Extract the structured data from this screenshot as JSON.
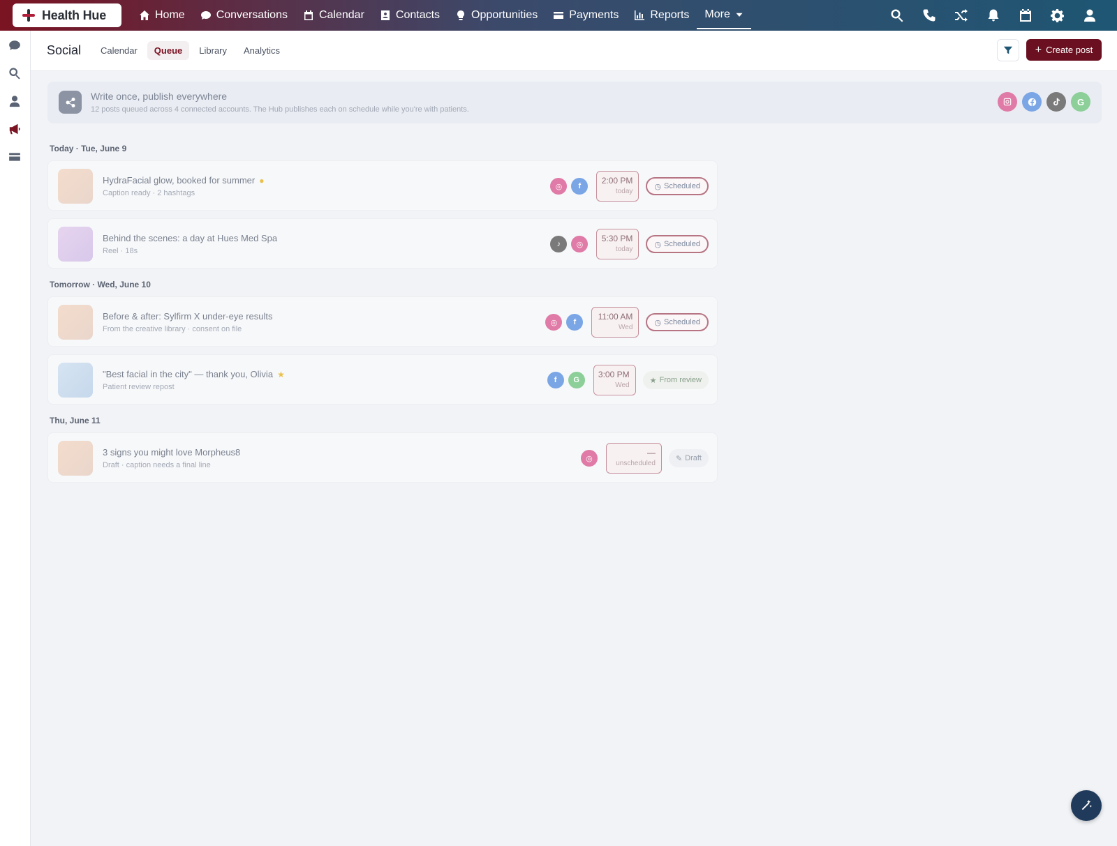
{
  "brand": {
    "name": "Health Hue"
  },
  "nav": {
    "items": [
      {
        "label": "Home",
        "icon": "home-icon"
      },
      {
        "label": "Conversations",
        "icon": "chat-icon"
      },
      {
        "label": "Calendar",
        "icon": "calendar-icon"
      },
      {
        "label": "Contacts",
        "icon": "contact-card-icon"
      },
      {
        "label": "Opportunities",
        "icon": "lightbulb-icon"
      },
      {
        "label": "Payments",
        "icon": "credit-card-icon"
      },
      {
        "label": "Reports",
        "icon": "bar-chart-icon"
      },
      {
        "label": "More",
        "icon": "caret-down-icon"
      }
    ],
    "right_icons": [
      "search-icon",
      "phone-icon",
      "shuffle-icon",
      "bell-icon",
      "calendar-icon",
      "gear-icon",
      "user-icon"
    ]
  },
  "rail": {
    "icons": [
      "chat-icon",
      "search-icon",
      "person-icon",
      "megaphone-icon",
      "card-icon"
    ]
  },
  "subheader": {
    "title": "Social",
    "tabs": [
      "Calendar",
      "Queue",
      "Library",
      "Analytics"
    ],
    "active_tab": "Queue",
    "create_label": "Create post"
  },
  "banner": {
    "title": "Write once, publish everywhere",
    "subtitle": "12 posts queued across 4 connected accounts. The Hub publishes each on schedule while you're with patients.",
    "accounts": [
      "instagram",
      "facebook",
      "tiktok",
      "google"
    ]
  },
  "queue": {
    "days": [
      {
        "label": "Today · Tue, June 9"
      },
      {
        "label": "Tomorrow · Wed, June 10"
      },
      {
        "label": "Thu, June 11"
      }
    ],
    "posts": [
      {
        "title": "HydraFacial glow, booked for summer",
        "subtitle": "Caption ready · 2 hashtags",
        "time": "2:00 PM",
        "when": "today",
        "status": "Scheduled"
      },
      {
        "title": "Behind the scenes: a day at Hues Med Spa",
        "subtitle": "Reel · 18s",
        "time": "5:30 PM",
        "when": "today",
        "status": "Scheduled"
      },
      {
        "title": "Before & after: Sylfirm X under-eye results",
        "subtitle": "From the creative library · consent on file",
        "time": "11:00 AM",
        "when": "Wed",
        "status": "Scheduled"
      },
      {
        "title": "\"Best facial in the city\" — thank you, Olivia",
        "subtitle": "Patient review repost",
        "time": "3:00 PM",
        "when": "Wed",
        "status": "From review"
      },
      {
        "title": "3 signs you might love Morpheus8",
        "subtitle": "Draft · caption needs a final line",
        "time": "—",
        "when": "unscheduled",
        "status": "Draft"
      }
    ]
  },
  "colors": {
    "brand": "#7a1322",
    "instagram": "#e07aa6",
    "facebook": "#7aa6e6",
    "tiktok": "#7a7a7a",
    "google": "#8ccf98"
  }
}
